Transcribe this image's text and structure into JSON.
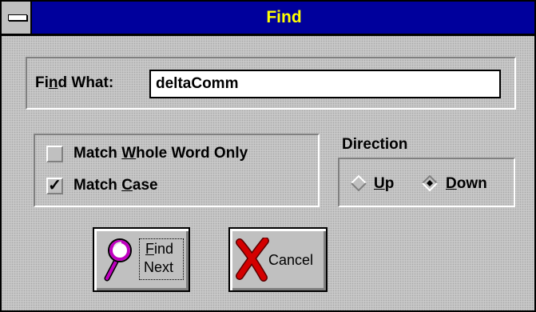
{
  "window": {
    "title": "Find"
  },
  "find_what": {
    "label_prefix": "Fi",
    "label_mnemonic": "n",
    "label_suffix": "d What:",
    "value": "deltaComm"
  },
  "options": {
    "whole_word": {
      "label_prefix": "Match ",
      "label_mnemonic": "W",
      "label_suffix": "hole Word Only",
      "checked": false
    },
    "match_case": {
      "label_prefix": "Match ",
      "label_mnemonic": "C",
      "label_suffix": "ase",
      "checked": true,
      "check_glyph": "✓"
    }
  },
  "direction": {
    "label": "Direction",
    "up": {
      "label_mnemonic": "U",
      "label_suffix": "p",
      "selected": false
    },
    "down": {
      "label_mnemonic": "D",
      "label_suffix": "own",
      "selected": true
    }
  },
  "buttons": {
    "find_next": {
      "line1_mnemonic": "F",
      "line1_suffix": "ind",
      "line2": "Next",
      "icon": "magnifier-icon"
    },
    "cancel": {
      "label": "Cancel",
      "icon": "red-x-icon"
    }
  },
  "colors": {
    "title_bar": "#00009c",
    "title_text": "#ffff00",
    "cancel_x": "#d40000",
    "magnifier": "#c000c0"
  }
}
